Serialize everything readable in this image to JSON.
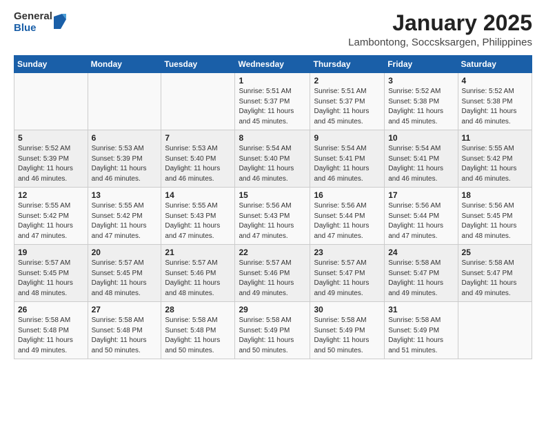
{
  "header": {
    "logo_general": "General",
    "logo_blue": "Blue",
    "title": "January 2025",
    "subtitle": "Lambontong, Soccsksargen, Philippines"
  },
  "days_of_week": [
    "Sunday",
    "Monday",
    "Tuesday",
    "Wednesday",
    "Thursday",
    "Friday",
    "Saturday"
  ],
  "weeks": [
    [
      {
        "day": "",
        "info": ""
      },
      {
        "day": "",
        "info": ""
      },
      {
        "day": "",
        "info": ""
      },
      {
        "day": "1",
        "info": "Sunrise: 5:51 AM\nSunset: 5:37 PM\nDaylight: 11 hours\nand 45 minutes."
      },
      {
        "day": "2",
        "info": "Sunrise: 5:51 AM\nSunset: 5:37 PM\nDaylight: 11 hours\nand 45 minutes."
      },
      {
        "day": "3",
        "info": "Sunrise: 5:52 AM\nSunset: 5:38 PM\nDaylight: 11 hours\nand 45 minutes."
      },
      {
        "day": "4",
        "info": "Sunrise: 5:52 AM\nSunset: 5:38 PM\nDaylight: 11 hours\nand 46 minutes."
      }
    ],
    [
      {
        "day": "5",
        "info": "Sunrise: 5:52 AM\nSunset: 5:39 PM\nDaylight: 11 hours\nand 46 minutes."
      },
      {
        "day": "6",
        "info": "Sunrise: 5:53 AM\nSunset: 5:39 PM\nDaylight: 11 hours\nand 46 minutes."
      },
      {
        "day": "7",
        "info": "Sunrise: 5:53 AM\nSunset: 5:40 PM\nDaylight: 11 hours\nand 46 minutes."
      },
      {
        "day": "8",
        "info": "Sunrise: 5:54 AM\nSunset: 5:40 PM\nDaylight: 11 hours\nand 46 minutes."
      },
      {
        "day": "9",
        "info": "Sunrise: 5:54 AM\nSunset: 5:41 PM\nDaylight: 11 hours\nand 46 minutes."
      },
      {
        "day": "10",
        "info": "Sunrise: 5:54 AM\nSunset: 5:41 PM\nDaylight: 11 hours\nand 46 minutes."
      },
      {
        "day": "11",
        "info": "Sunrise: 5:55 AM\nSunset: 5:42 PM\nDaylight: 11 hours\nand 46 minutes."
      }
    ],
    [
      {
        "day": "12",
        "info": "Sunrise: 5:55 AM\nSunset: 5:42 PM\nDaylight: 11 hours\nand 47 minutes."
      },
      {
        "day": "13",
        "info": "Sunrise: 5:55 AM\nSunset: 5:42 PM\nDaylight: 11 hours\nand 47 minutes."
      },
      {
        "day": "14",
        "info": "Sunrise: 5:55 AM\nSunset: 5:43 PM\nDaylight: 11 hours\nand 47 minutes."
      },
      {
        "day": "15",
        "info": "Sunrise: 5:56 AM\nSunset: 5:43 PM\nDaylight: 11 hours\nand 47 minutes."
      },
      {
        "day": "16",
        "info": "Sunrise: 5:56 AM\nSunset: 5:44 PM\nDaylight: 11 hours\nand 47 minutes."
      },
      {
        "day": "17",
        "info": "Sunrise: 5:56 AM\nSunset: 5:44 PM\nDaylight: 11 hours\nand 47 minutes."
      },
      {
        "day": "18",
        "info": "Sunrise: 5:56 AM\nSunset: 5:45 PM\nDaylight: 11 hours\nand 48 minutes."
      }
    ],
    [
      {
        "day": "19",
        "info": "Sunrise: 5:57 AM\nSunset: 5:45 PM\nDaylight: 11 hours\nand 48 minutes."
      },
      {
        "day": "20",
        "info": "Sunrise: 5:57 AM\nSunset: 5:45 PM\nDaylight: 11 hours\nand 48 minutes."
      },
      {
        "day": "21",
        "info": "Sunrise: 5:57 AM\nSunset: 5:46 PM\nDaylight: 11 hours\nand 48 minutes."
      },
      {
        "day": "22",
        "info": "Sunrise: 5:57 AM\nSunset: 5:46 PM\nDaylight: 11 hours\nand 49 minutes."
      },
      {
        "day": "23",
        "info": "Sunrise: 5:57 AM\nSunset: 5:47 PM\nDaylight: 11 hours\nand 49 minutes."
      },
      {
        "day": "24",
        "info": "Sunrise: 5:58 AM\nSunset: 5:47 PM\nDaylight: 11 hours\nand 49 minutes."
      },
      {
        "day": "25",
        "info": "Sunrise: 5:58 AM\nSunset: 5:47 PM\nDaylight: 11 hours\nand 49 minutes."
      }
    ],
    [
      {
        "day": "26",
        "info": "Sunrise: 5:58 AM\nSunset: 5:48 PM\nDaylight: 11 hours\nand 49 minutes."
      },
      {
        "day": "27",
        "info": "Sunrise: 5:58 AM\nSunset: 5:48 PM\nDaylight: 11 hours\nand 50 minutes."
      },
      {
        "day": "28",
        "info": "Sunrise: 5:58 AM\nSunset: 5:48 PM\nDaylight: 11 hours\nand 50 minutes."
      },
      {
        "day": "29",
        "info": "Sunrise: 5:58 AM\nSunset: 5:49 PM\nDaylight: 11 hours\nand 50 minutes."
      },
      {
        "day": "30",
        "info": "Sunrise: 5:58 AM\nSunset: 5:49 PM\nDaylight: 11 hours\nand 50 minutes."
      },
      {
        "day": "31",
        "info": "Sunrise: 5:58 AM\nSunset: 5:49 PM\nDaylight: 11 hours\nand 51 minutes."
      },
      {
        "day": "",
        "info": ""
      }
    ]
  ]
}
